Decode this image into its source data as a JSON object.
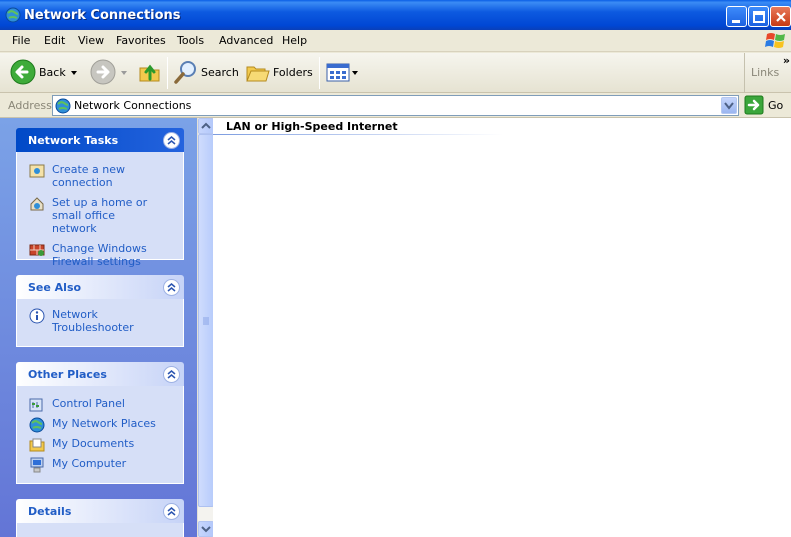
{
  "window": {
    "title": "Network Connections"
  },
  "menu": [
    "File",
    "Edit",
    "View",
    "Favorites",
    "Tools",
    "Advanced",
    "Help"
  ],
  "toolbar": {
    "back_label": "Back",
    "search_label": "Search",
    "folders_label": "Folders",
    "links_label": "Links"
  },
  "address": {
    "label": "Address",
    "value": "Network Connections",
    "go_label": "Go"
  },
  "panels": {
    "network_tasks": {
      "title": "Network Tasks",
      "items": [
        "Create a new connection",
        "Set up a home or small office network",
        "Change Windows Firewall settings"
      ]
    },
    "see_also": {
      "title": "See Also",
      "items": [
        "Network Troubleshooter"
      ]
    },
    "other_places": {
      "title": "Other Places",
      "items": [
        "Control Panel",
        "My Network Places",
        "My Documents",
        "My Computer"
      ]
    },
    "details": {
      "title": "Details"
    }
  },
  "content": {
    "group_header": "LAN or High-Speed Internet"
  },
  "colors": {
    "title_bar": "#0047d4",
    "task_link": "#215dc6",
    "left_pane": "#7ba2e7",
    "panel_body": "#d6dff7"
  }
}
